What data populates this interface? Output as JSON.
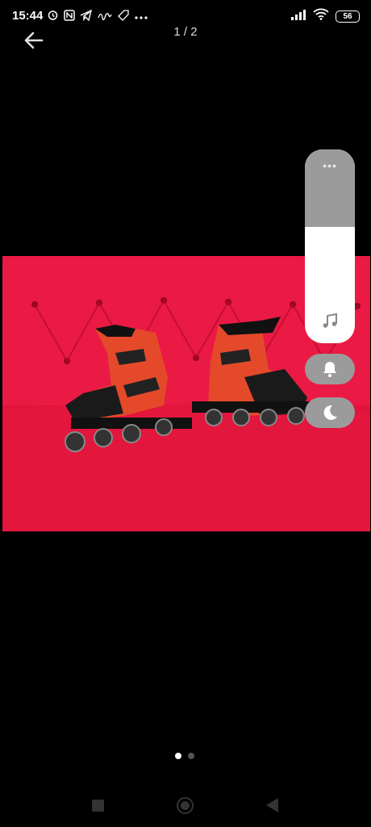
{
  "status_bar": {
    "time": "15:44",
    "battery": "56",
    "icons": [
      "alarm-icon",
      "nfc-icon",
      "telegram-icon",
      "app-icon",
      "tag-icon",
      "more-icon"
    ]
  },
  "header": {
    "counter": "1 / 2"
  },
  "panel": {
    "dots": "•••"
  },
  "pager": {
    "current": 1,
    "total": 2
  },
  "colors": {
    "background": "#000000",
    "panel_gray": "#9b9b9b",
    "sofa_red": "#e0143a",
    "skate_orange": "#e44a2a"
  }
}
